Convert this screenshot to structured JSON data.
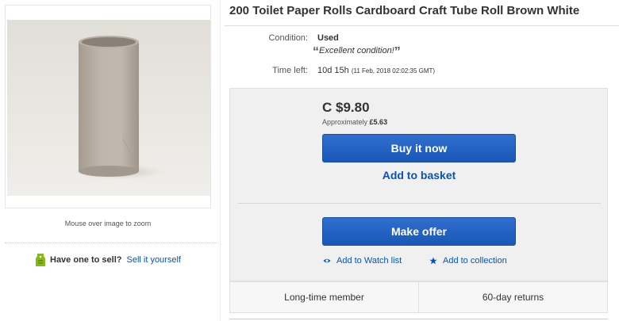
{
  "listing": {
    "title": "200 Toilet Paper Rolls Cardboard Craft Tube Roll Brown White"
  },
  "image_panel": {
    "zoom_hint": "Mouse over image to zoom"
  },
  "sell_promo": {
    "question": "Have one to sell?",
    "link": "Sell it yourself",
    "icon": "price-tag-icon",
    "icon_color": "#86b817"
  },
  "details": {
    "condition_label": "Condition:",
    "condition_value": "Used",
    "condition_note": "Excellent condition!",
    "time_label": "Time left:",
    "time_value": "10d 15h",
    "time_end": "(11 Feb, 2018  02:02:35 GMT)"
  },
  "purchase": {
    "price": "C $9.80",
    "approx_prefix": "Approximately",
    "approx_value": "£5.63",
    "buy_now_label": "Buy it now",
    "add_to_basket_label": "Add to basket",
    "make_offer_label": "Make offer",
    "watch_label": "Add to Watch list",
    "watch_icon": "eye-icon",
    "collection_label": "Add to collection",
    "collection_icon": "star-icon",
    "button_color": "#1f5fc4",
    "link_color": "#0654ba"
  },
  "badges": [
    "Long-time member",
    "60-day returns"
  ]
}
